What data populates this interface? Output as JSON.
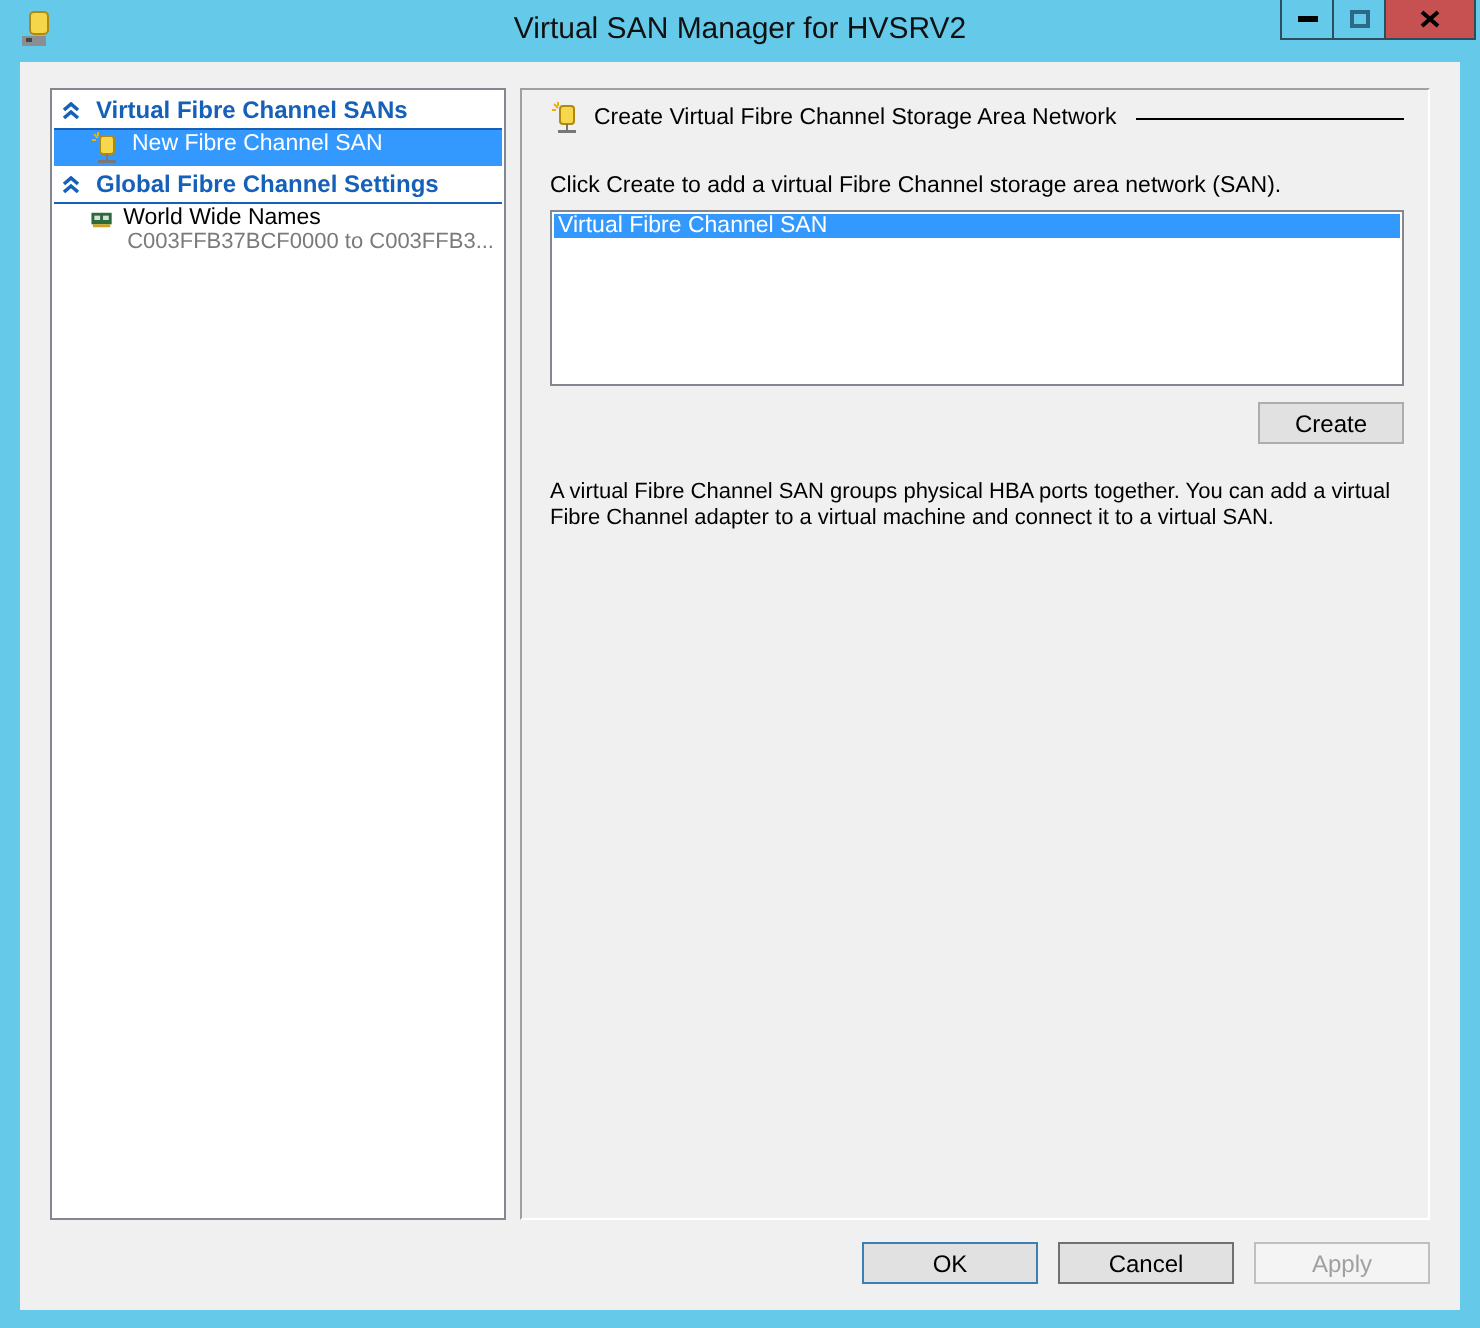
{
  "window": {
    "title": "Virtual SAN Manager for HVSRV2"
  },
  "sidebar": {
    "sections": [
      {
        "label": "Virtual Fibre Channel SANs",
        "expanded": true,
        "items": [
          {
            "kind": "san",
            "label": "New Fibre Channel SAN",
            "selected": true
          }
        ]
      },
      {
        "label": "Global Fibre Channel Settings",
        "expanded": true,
        "items": [
          {
            "kind": "wwn",
            "label": "World Wide Names",
            "detail": "C003FFB37BCF0000 to C003FFB3...",
            "selected": false
          }
        ]
      }
    ]
  },
  "panel": {
    "heading": "Create Virtual Fibre Channel Storage Area Network",
    "instruction": "Click Create to add a virtual Fibre Channel storage area network (SAN).",
    "list": [
      {
        "label": "Virtual Fibre Channel SAN",
        "selected": true
      }
    ],
    "create_button": "Create",
    "description": "A virtual Fibre Channel SAN groups physical HBA ports together. You can add a virtual Fibre Channel adapter to a virtual machine and connect it to a virtual SAN."
  },
  "buttons": [
    {
      "label": "OK",
      "kind": "default",
      "disabled": false
    },
    {
      "label": "Cancel",
      "kind": "normal",
      "disabled": false
    },
    {
      "label": "Apply",
      "kind": "normal",
      "disabled": true
    }
  ]
}
